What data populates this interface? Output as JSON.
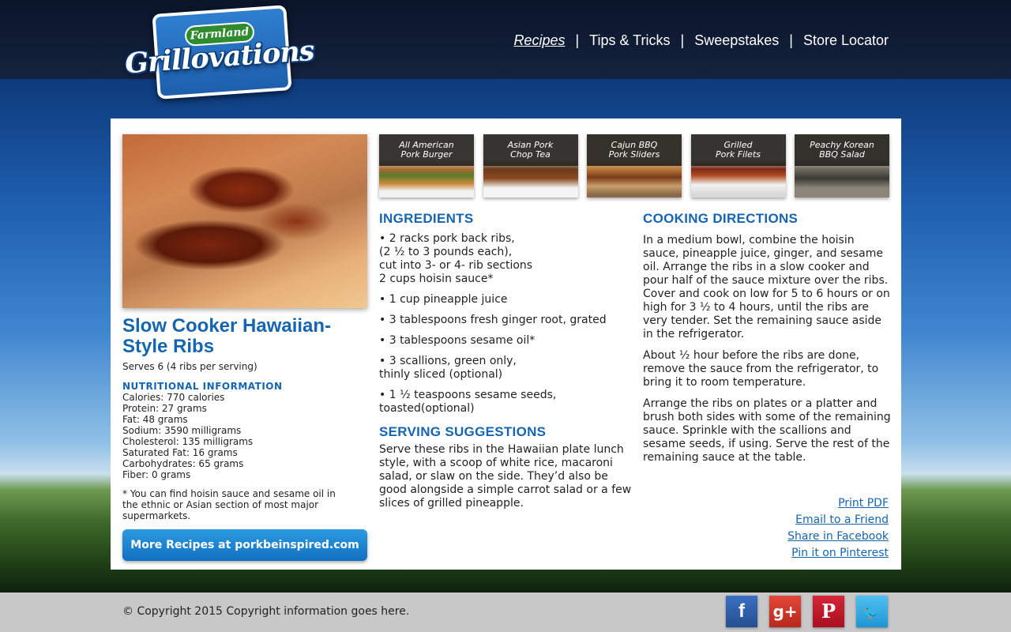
{
  "logo": {
    "brand": "Farmland",
    "product": "Grillovations"
  },
  "nav": {
    "items": [
      {
        "label": "Recipes",
        "active": true
      },
      {
        "label": "Tips & Tricks",
        "active": false
      },
      {
        "label": "Sweepstakes",
        "active": false
      },
      {
        "label": "Store Locator",
        "active": false
      }
    ],
    "separator": "|"
  },
  "recipe": {
    "title": "Slow Cooker Hawaiian-Style Ribs",
    "serves": "Serves 6 (4 ribs per serving)",
    "nutrition_heading": "NUTRITIONAL INFORMATION",
    "nutrition": [
      "Calories: 770 calories",
      "Protein: 27 grams",
      "Fat: 48 grams",
      "Sodium: 3590 milligrams",
      "Cholesterol: 135 milligrams",
      "Saturated Fat: 16 grams",
      "Carbohydrates: 65 grams",
      "Fiber: 0 grams"
    ],
    "footnote": "* You can find hoisin sauce and sesame oil in the ethnic or Asian section of most major supermarkets.",
    "more_button": "More Recipes at porkbeinspired.com"
  },
  "thumbnails": [
    {
      "caption_line1": "All American",
      "caption_line2": "Pork Burger"
    },
    {
      "caption_line1": "Asian Pork",
      "caption_line2": "Chop Tea"
    },
    {
      "caption_line1": "Cajun BBQ",
      "caption_line2": "Pork Sliders"
    },
    {
      "caption_line1": "Grilled",
      "caption_line2": "Pork Filets"
    },
    {
      "caption_line1": "Peachy Korean",
      "caption_line2": "BBQ Salad"
    }
  ],
  "ingredients": {
    "heading": "INGREDIENTS",
    "items": [
      "• 2 racks pork back ribs,\n  (2 ½ to 3 pounds each),\n  cut into 3- or 4- rib sections\n  2 cups hoisin sauce*",
      "• 1 cup pineapple juice",
      "• 3 tablespoons fresh ginger root, grated",
      "• 3 tablespoons sesame oil*",
      "• 3 scallions, green only,\n   thinly sliced (optional)",
      "• 1 ½ teaspoons sesame seeds,\n   toasted(optional)"
    ]
  },
  "serving": {
    "heading": "SERVING SUGGESTIONS",
    "text": "Serve these ribs in the Hawaiian plate lunch style, with a scoop of white rice, macaroni salad, or slaw on the side. They’d also be good alongside a simple carrot salad or a few slices of grilled pineapple."
  },
  "directions": {
    "heading": "COOKING DIRECTIONS",
    "paragraphs": [
      "In a medium bowl, combine the hoisin sauce, pineapple juice, ginger, and sesame oil. Arrange the ribs in a slow cooker and pour half of the sauce mixture over the ribs. Cover and cook on low for 5 to 6 hours or on high for 3 ½ to 4 hours, until the ribs are very tender. Set the remaining sauce aside in the refrigerator.",
      "About ½ hour before the ribs are done, remove the sauce from the refrigerator, to bring it to room temperature.",
      "Arrange the ribs on plates or a platter and brush both sides with some of the remaining sauce. Sprinkle with the scallions and sesame seeds, if using. Serve the rest of the remaining sauce at the table."
    ]
  },
  "actions": {
    "print": "Print PDF",
    "email": "Email to a Friend",
    "facebook": "Share in Facebook",
    "pinterest": "Pin it on Pinterest"
  },
  "footer": {
    "copyright": "© Copyright 2015 Copyright information goes here.",
    "social": [
      {
        "icon": "facebook-icon",
        "glyph": "f"
      },
      {
        "icon": "google-plus-icon",
        "glyph": "g+"
      },
      {
        "icon": "pinterest-icon",
        "glyph": "P"
      },
      {
        "icon": "twitter-icon",
        "glyph": "🐦"
      }
    ]
  },
  "colors": {
    "accent": "#1565b0",
    "header": "#0d1a33",
    "footer": "#c8c8c8"
  }
}
